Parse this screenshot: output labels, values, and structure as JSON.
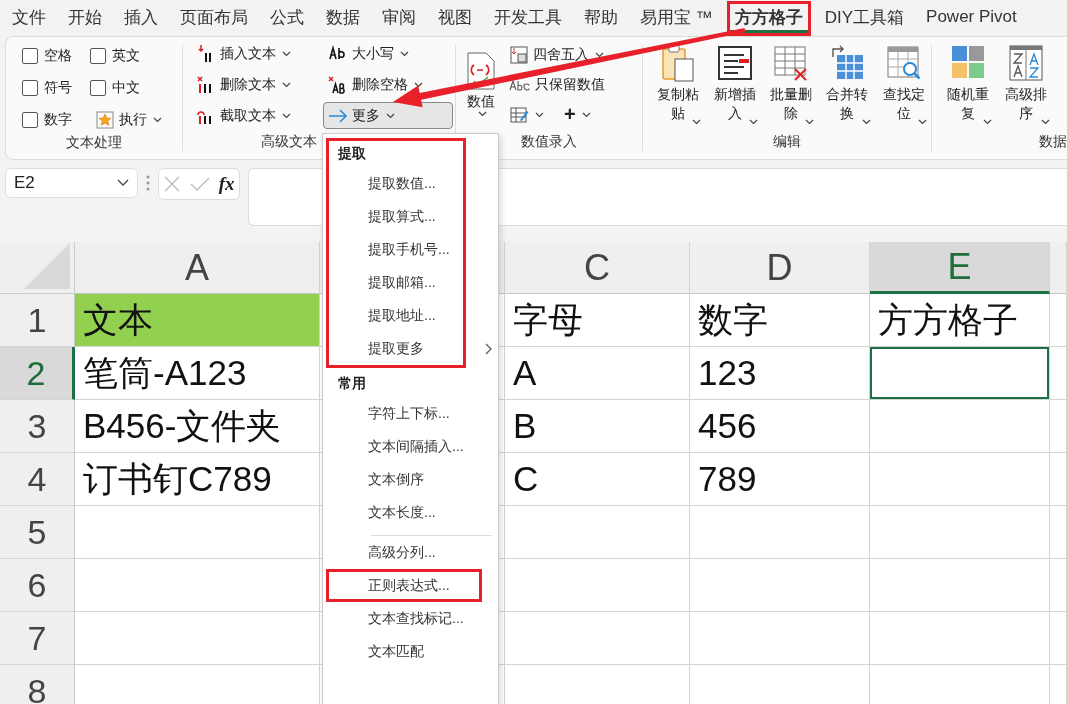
{
  "menu_tabs": [
    {
      "label": "文件",
      "selected": false,
      "highlighted": false
    },
    {
      "label": "开始",
      "selected": false,
      "highlighted": false
    },
    {
      "label": "插入",
      "selected": false,
      "highlighted": false
    },
    {
      "label": "页面布局",
      "selected": false,
      "highlighted": false
    },
    {
      "label": "公式",
      "selected": false,
      "highlighted": false
    },
    {
      "label": "数据",
      "selected": false,
      "highlighted": false
    },
    {
      "label": "审阅",
      "selected": false,
      "highlighted": false
    },
    {
      "label": "视图",
      "selected": false,
      "highlighted": false
    },
    {
      "label": "开发工具",
      "selected": false,
      "highlighted": false
    },
    {
      "label": "帮助",
      "selected": false,
      "highlighted": false
    },
    {
      "label": "易用宝 ™",
      "selected": false,
      "highlighted": false
    },
    {
      "label": "方方格子",
      "selected": true,
      "highlighted": true
    },
    {
      "label": "DIY工具箱",
      "selected": false,
      "highlighted": false
    },
    {
      "label": "Power Pivot",
      "selected": false,
      "highlighted": false
    }
  ],
  "ribbon": {
    "text_processing": {
      "label": "文本处理",
      "checkboxes": [
        {
          "label": "空格",
          "checked": false
        },
        {
          "label": "英文",
          "checked": false
        },
        {
          "label": "符号",
          "checked": false
        },
        {
          "label": "中文",
          "checked": false
        },
        {
          "label": "数字",
          "checked": false
        }
      ],
      "execute": "执行"
    },
    "advanced_text": {
      "label": "高级文本",
      "buttons": [
        {
          "label": "插入文本",
          "pressed": false
        },
        {
          "label": "删除文本",
          "pressed": false
        },
        {
          "label": "截取文本",
          "pressed": false
        },
        {
          "label": "大小写",
          "pressed": false
        },
        {
          "label": "删除空格",
          "pressed": false
        },
        {
          "label": "更多",
          "pressed": true
        }
      ]
    },
    "value_entry": {
      "label": "数值录入",
      "big_button": "数值",
      "round": "四舍五入",
      "keep_values": "只保留数值",
      "plus": "+"
    },
    "edit": {
      "label": "编辑",
      "buttons": [
        "复制粘贴",
        "新增插入",
        "批量删除",
        "合并转换",
        "查找定位"
      ]
    },
    "data": {
      "label": "数据",
      "buttons": [
        "随机重复",
        "高级排序"
      ]
    }
  },
  "formula_bar": {
    "name_box": "E2",
    "fx": "fx"
  },
  "sheet": {
    "columns": [
      {
        "label": "A",
        "selected": false
      },
      {
        "label": "C",
        "selected": false
      },
      {
        "label": "D",
        "selected": false
      },
      {
        "label": "E",
        "selected": true
      }
    ],
    "rows": [
      {
        "header": "1",
        "selected": false,
        "cells": [
          {
            "text": "文本",
            "color": "#92d050",
            "active": false
          },
          {
            "text": "字母",
            "active": false
          },
          {
            "text": "数字",
            "active": false
          },
          {
            "text": "方方格子",
            "active": false
          }
        ]
      },
      {
        "header": "2",
        "selected": true,
        "cells": [
          {
            "text": "笔筒-A123",
            "active": false
          },
          {
            "text": "A",
            "active": false
          },
          {
            "text": "123",
            "active": false
          },
          {
            "active": true
          }
        ]
      },
      {
        "header": "3",
        "selected": false,
        "cells": [
          {
            "text": "B456-文件夹",
            "active": false
          },
          {
            "text": "B",
            "active": false
          },
          {
            "text": "456",
            "active": false
          },
          {
            "active": false
          }
        ]
      },
      {
        "header": "4",
        "selected": false,
        "cells": [
          {
            "text": "订书钉C789",
            "active": false
          },
          {
            "text": "C",
            "active": false
          },
          {
            "text": "789",
            "active": false
          },
          {
            "active": false
          }
        ]
      },
      {
        "header": "5",
        "selected": false
      },
      {
        "header": "6",
        "selected": false
      },
      {
        "header": "7",
        "selected": false
      },
      {
        "header": "8",
        "selected": false
      }
    ]
  },
  "dropdown": {
    "sections": [
      {
        "heading": "提取",
        "highlighted": true,
        "items": [
          {
            "label": "提取数值...",
            "submenu": false,
            "highlighted": false
          },
          {
            "label": "提取算式...",
            "submenu": false,
            "highlighted": false
          },
          {
            "label": "提取手机号...",
            "submenu": false,
            "highlighted": false
          },
          {
            "label": "提取邮箱...",
            "submenu": false,
            "highlighted": false
          },
          {
            "label": "提取地址...",
            "submenu": false,
            "highlighted": false
          },
          {
            "label": "提取更多",
            "submenu": true,
            "highlighted": false
          }
        ]
      },
      {
        "heading": "常用",
        "highlighted": false,
        "items": [
          {
            "label": "字符上下标...",
            "submenu": false,
            "highlighted": false
          },
          {
            "label": "文本间隔插入...",
            "submenu": false,
            "highlighted": false
          },
          {
            "label": "文本倒序",
            "submenu": false,
            "highlighted": false
          },
          {
            "label": "文本长度...",
            "submenu": false,
            "highlighted": false
          }
        ]
      },
      {
        "highlighted": false,
        "items": [
          {
            "label": "高级分列...",
            "submenu": false,
            "highlighted": false
          },
          {
            "label": "正则表达式...",
            "submenu": false,
            "highlighted": true
          },
          {
            "label": "文本查找标记...",
            "submenu": false,
            "highlighted": false
          },
          {
            "label": "文本匹配",
            "submenu": false,
            "highlighted": false
          }
        ]
      }
    ]
  }
}
